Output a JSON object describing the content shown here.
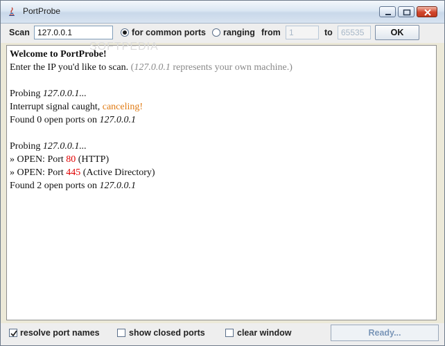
{
  "window": {
    "title": "PortProbe"
  },
  "toolbar": {
    "scan_label": "Scan",
    "ip_value": "127.0.0.1",
    "mode_common_label": "for common ports",
    "mode_ranging_label": "ranging",
    "from_label": "from",
    "from_value": "1",
    "to_label": "to",
    "to_value": "65535",
    "ok_label": "OK",
    "selected_mode": "for common ports"
  },
  "watermark": "SOFTPEDIA",
  "output": {
    "welcome": "Welcome to PortProbe!",
    "prompt_prefix": "Enter the IP you'd like to scan.",
    "prompt_open_paren": " (",
    "prompt_ip": "127.0.0.1",
    "prompt_suffix": " represents your own machine.)",
    "probing_label": "Probing ",
    "probe1_ip": "127.0.0.1...",
    "interrupt_prefix": "Interrupt signal caught, ",
    "interrupt_status": "canceling!",
    "found1_prefix": "Found 0 open ports on ",
    "found1_ip": "127.0.0.1",
    "probe2_ip": "127.0.0.1...",
    "open1_prefix": "» OPEN: Port ",
    "open1_port": "80",
    "open1_service": " (HTTP)",
    "open2_prefix": "» OPEN: Port ",
    "open2_port": "445",
    "open2_service": " (Active Directory)",
    "found2_prefix": "Found 2 open ports on ",
    "found2_ip": "127.0.0.1"
  },
  "options": {
    "resolve_label": "resolve port names",
    "resolve_checked": true,
    "closed_label": "show closed ports",
    "closed_checked": false,
    "clear_label": "clear window",
    "clear_checked": false
  },
  "status": {
    "text": "Ready..."
  },
  "colors": {
    "orange": "#e07a12",
    "red": "#e00000",
    "gray_text": "#888888"
  }
}
